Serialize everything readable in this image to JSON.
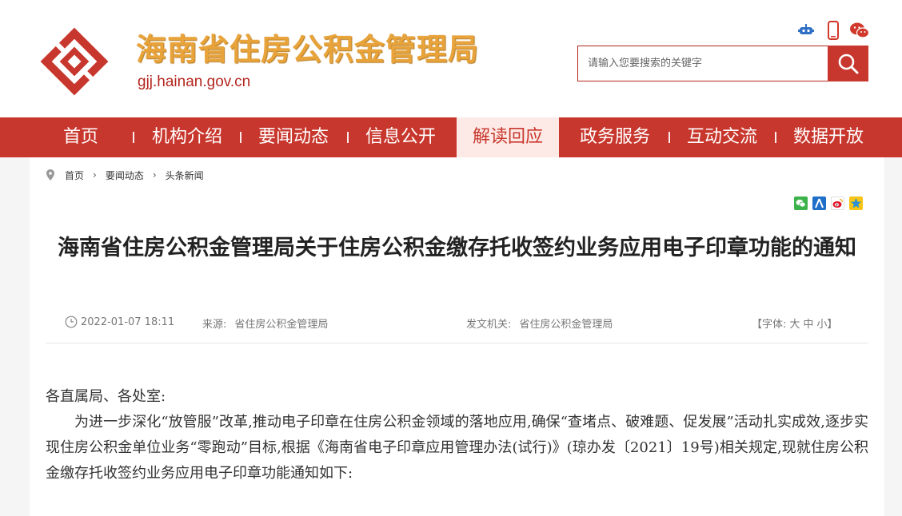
{
  "header": {
    "site_title": "海南省住房公积金管理局",
    "site_domain": "gjj.hainan.gov.cn",
    "search_placeholder": "请输入您要搜索的关键字",
    "icons": [
      "robot-icon",
      "mobile-phone-icon",
      "wechat-icon"
    ]
  },
  "nav": {
    "items": [
      {
        "label": "首页"
      },
      {
        "label": "机构介绍"
      },
      {
        "label": "要闻动态"
      },
      {
        "label": "信息公开"
      },
      {
        "label": "解读回应",
        "active": true
      },
      {
        "label": "政务服务"
      },
      {
        "label": "互动交流"
      },
      {
        "label": "数据开放"
      }
    ]
  },
  "breadcrumb": [
    "首页",
    "要闻动态",
    "头条新闻"
  ],
  "share_icons": [
    "wechat-share-icon",
    "renren-share-icon",
    "weibo-share-icon",
    "qzone-share-icon"
  ],
  "article": {
    "title": "海南省住房公积金管理局关于住房公积金缴存托收签约业务应用电子印章功能的通知",
    "datetime": "2022-01-07 18:11",
    "source_label": "来源:",
    "source": "省住房公积金管理局",
    "issuer_label": "发文机关:",
    "issuer": "省住房公积金管理局",
    "font_label": "【字体:",
    "font_large": "大",
    "font_medium": "中",
    "font_small": "小】",
    "salutation": "各直属局、各处室:",
    "paragraph1": "为进一步深化“放管服”改革,推动电子印章在住房公积金领域的落地应用,确保“查堵点、破难题、促发展”活动扎实成效,逐步实现住房公积金单位业务“零跑动”目标,根据《海南省电子印章应用管理办法(试行)》(琼办发〔2021〕19号)相关规定,现就住房公积金缴存托收签约业务应用电子印章功能通知如下:"
  },
  "colors": {
    "brand_red": "#c8372d",
    "title_gold": "#e8a33a",
    "active_nav_bg": "#fdeae6"
  }
}
